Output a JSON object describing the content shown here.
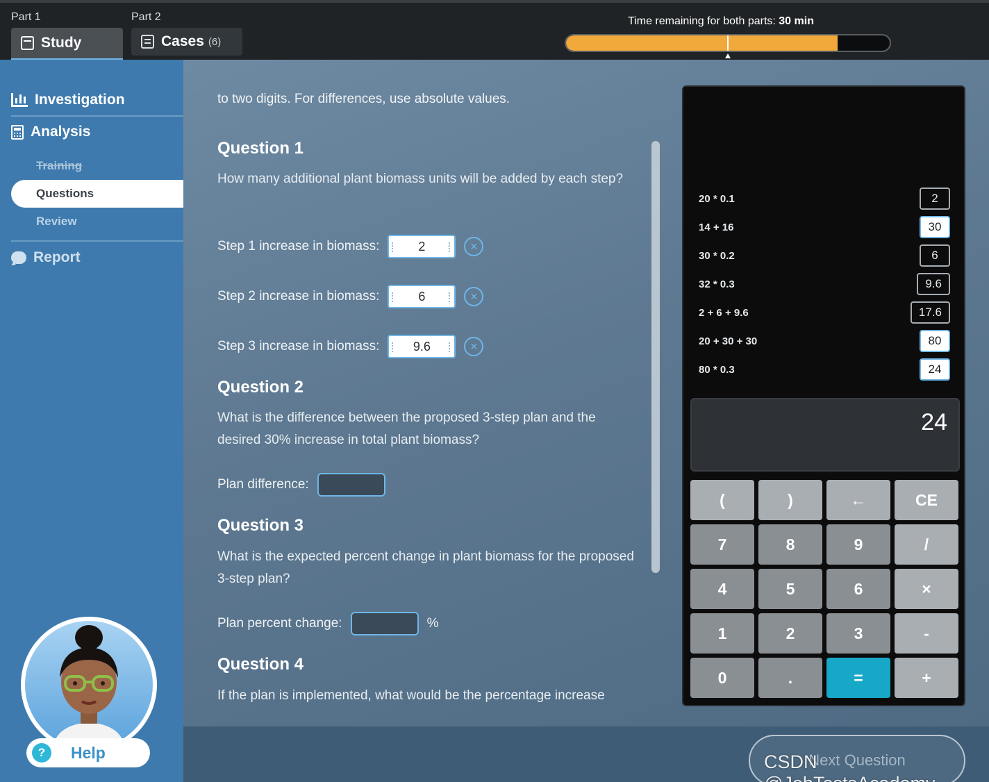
{
  "header": {
    "part1_label": "Part 1",
    "part2_label": "Part 2",
    "study_tab": "Study",
    "cases_tab": "Cases",
    "cases_count": "(6)",
    "timer_prefix": "Time remaining for both parts:",
    "timer_value": "30 min",
    "timer_fraction": 0.84
  },
  "sidebar": {
    "investigation": "Investigation",
    "analysis": "Analysis",
    "training": "Training",
    "questions": "Questions",
    "review": "Review",
    "report": "Report",
    "help": "Help",
    "help_symbol": "?"
  },
  "main": {
    "intro": "to two digits. For differences, use absolute values.",
    "q1": {
      "title": "Question 1",
      "text": "How many additional plant biomass units will be added by each step?",
      "fields": [
        {
          "label": "Step 1 increase in biomass:",
          "value": "2"
        },
        {
          "label": "Step 2 increase in biomass:",
          "value": "6"
        },
        {
          "label": "Step 3 increase in biomass:",
          "value": "9.6"
        }
      ]
    },
    "q2": {
      "title": "Question 2",
      "text": "What is the difference between the proposed 3-step plan and the desired 30% increase in total plant biomass?",
      "field_label": "Plan difference:"
    },
    "q3": {
      "title": "Question 3",
      "text": "What is the expected percent change in plant biomass for the proposed 3-step plan?",
      "field_label": "Plan percent change:",
      "unit": "%"
    },
    "q4": {
      "title": "Question 4",
      "text": "If the plan is implemented, what would be the percentage increase"
    },
    "clear_symbol": "×"
  },
  "calculator": {
    "history": [
      {
        "expr": "20 * 0.1",
        "value": "2",
        "selected": false
      },
      {
        "expr": "14 + 16",
        "value": "30",
        "selected": true
      },
      {
        "expr": "30 * 0.2",
        "value": "6",
        "selected": false
      },
      {
        "expr": "32 * 0.3",
        "value": "9.6",
        "selected": false
      },
      {
        "expr": "2 + 6 + 9.6",
        "value": "17.6",
        "selected": false
      },
      {
        "expr": "20 + 30 + 30",
        "value": "80",
        "selected": true
      },
      {
        "expr": "80 * 0.3",
        "value": "24",
        "selected": true
      }
    ],
    "display": "24",
    "keys": [
      "(",
      ")",
      "←",
      "CE",
      "7",
      "8",
      "9",
      "/",
      "4",
      "5",
      "6",
      "×",
      "1",
      "2",
      "3",
      "-",
      "0",
      ".",
      "=",
      "+"
    ]
  },
  "footer": {
    "next_label": "Next Question",
    "watermark": "CSDN @JobTestsAcademy"
  }
}
